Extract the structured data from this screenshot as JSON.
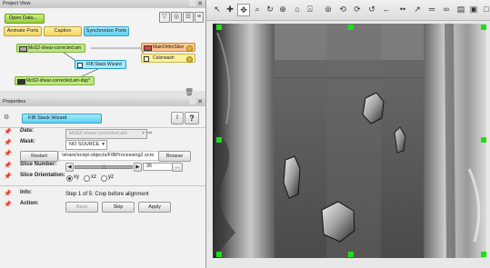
{
  "project_view": {
    "title": "Project View",
    "open_data": "Open Data...",
    "buttons": {
      "animate_ports": "Animate Ports",
      "caption": "Caption",
      "synchronize_ports": "Synchronize Ports"
    },
    "nodes": [
      {
        "label": "MoS2-shear-corrected.am",
        "color": "green"
      },
      {
        "label": "FIB Stack Wizard",
        "color": "cyan"
      },
      {
        "label": "MoS2-shear-corrected.am-dup*",
        "color": "green"
      },
      {
        "label": "MainOrthoSlice",
        "color": "orange"
      },
      {
        "label": "Colorwash",
        "color": "yellow"
      }
    ]
  },
  "properties": {
    "title": "Properties",
    "module_name": "FIB Stack Wizard",
    "data_label": "Data:",
    "data_value": "MoS2-shear-corrected.am",
    "mask_label": "Mask:",
    "mask_value": "NO SOURCE",
    "restart_button": "Restart",
    "script_path": "\\share/script-objects/FIBProcessing2.scro",
    "browse_button": "Browse",
    "slice_number_label": "Slice Number:",
    "slice_number_value": "35",
    "slice_orientation_label": "Slice Orientation:",
    "orientation_options": [
      "xy",
      "xz",
      "yz"
    ],
    "orientation_selected": "xy",
    "info_label": "Info:",
    "info_text": "Step 1 of 5: Crop before alignment",
    "action_label": "Action:",
    "actions": {
      "back": "Back",
      "skip": "Skip",
      "apply": "Apply"
    },
    "help_button": "?"
  },
  "colors": {
    "accent_green": "#19e019",
    "node_cyan": "#a5eaff",
    "node_green": "#bde87e"
  }
}
